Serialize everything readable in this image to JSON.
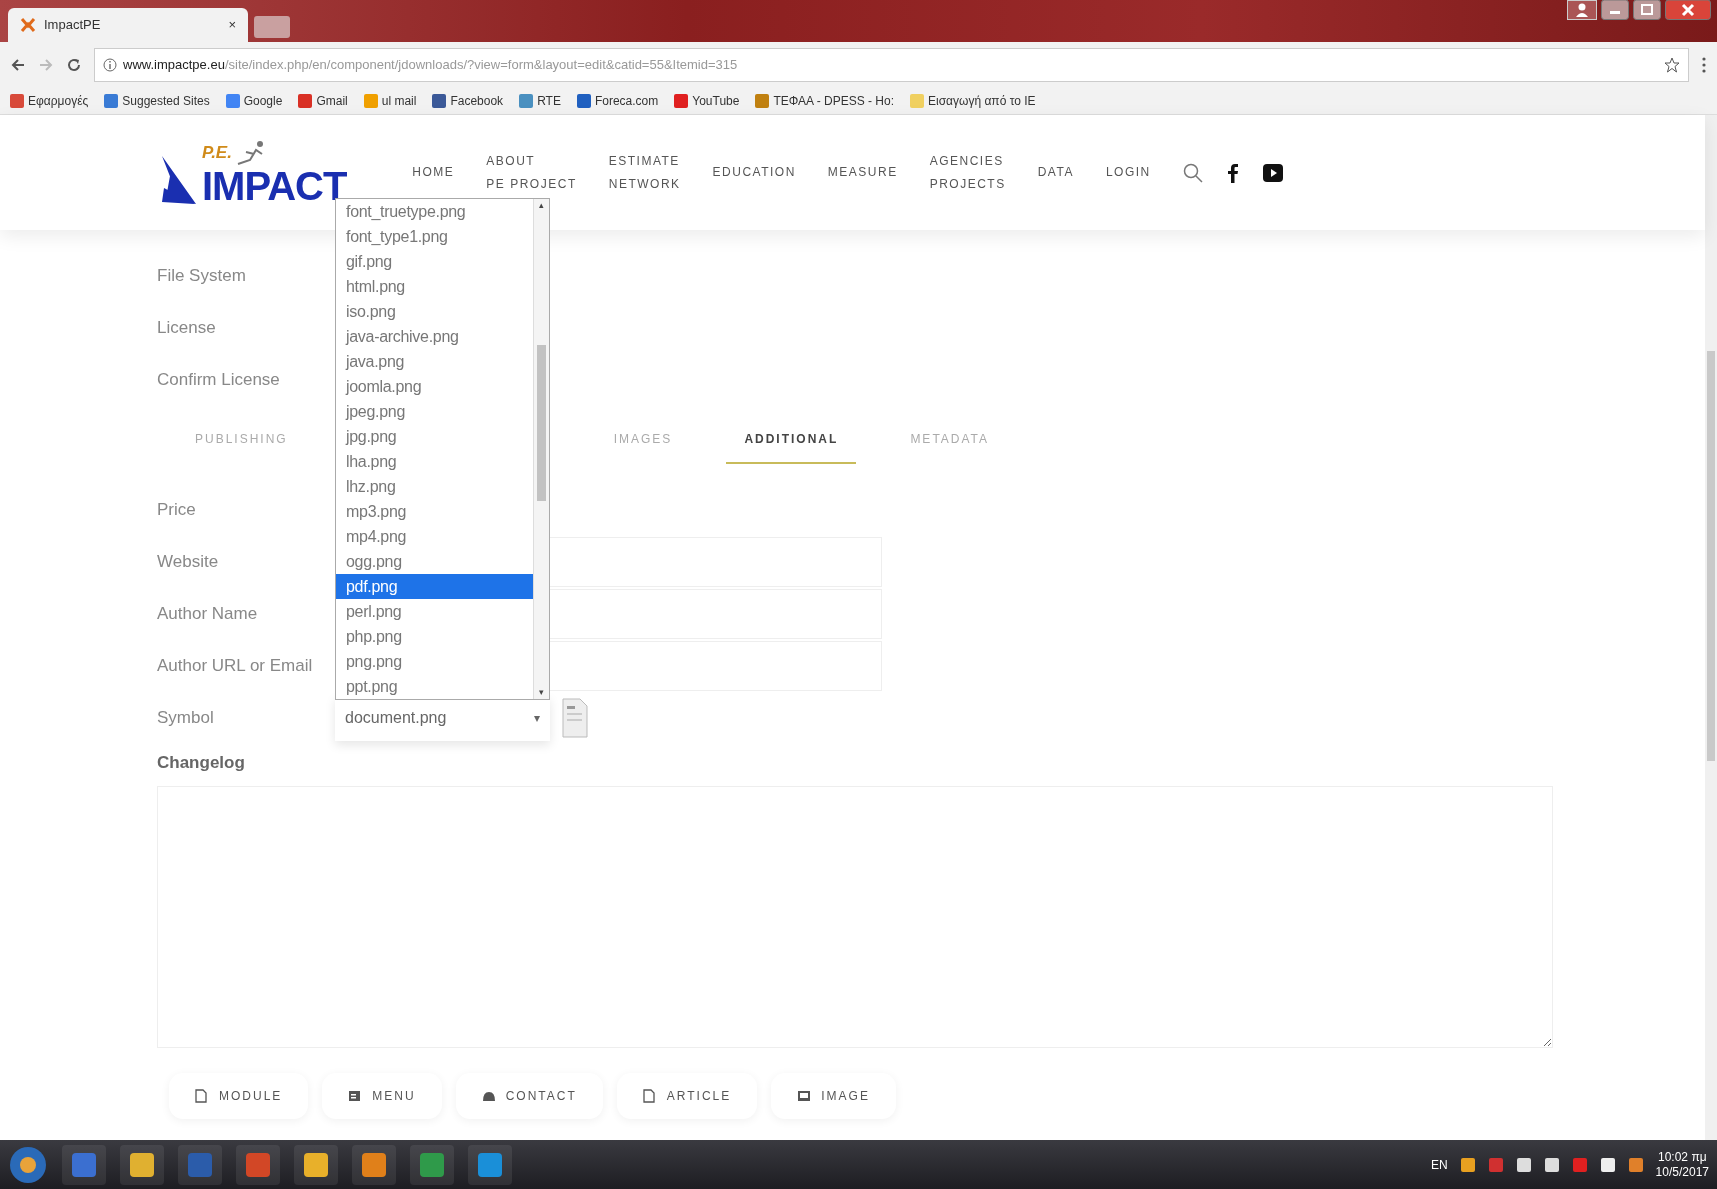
{
  "browser": {
    "tabs": [
      {
        "title": "ImpactPE",
        "close": "×",
        "selected": true
      }
    ],
    "address": {
      "host": "www.impactpe.eu",
      "path": "/site/index.php/en/component/jdownloads/?view=form&layout=edit&catid=55&Itemid=315"
    },
    "bookmarks": [
      {
        "label": "Εφαρμογές",
        "color": "#d84a3a"
      },
      {
        "label": "Suggested Sites",
        "color": "#3a7bd5"
      },
      {
        "label": "Google",
        "color": "#4285f4"
      },
      {
        "label": "Gmail",
        "color": "#d93025"
      },
      {
        "label": "ul mail",
        "color": "#f0a000"
      },
      {
        "label": "Facebook",
        "color": "#3b5998"
      },
      {
        "label": "RTE",
        "color": "#4a90c0"
      },
      {
        "label": "Foreca.com",
        "color": "#2060c0"
      },
      {
        "label": "YouTube",
        "color": "#e02020"
      },
      {
        "label": "ΤΕΦΑΑ - DPESS - Ho:",
        "color": "#c08010"
      },
      {
        "label": "Εισαγωγή από το IE",
        "color": "#f0d060"
      }
    ]
  },
  "site": {
    "logo": {
      "small": "P.E.",
      "big": "IMPACT"
    },
    "nav": [
      {
        "lines": [
          "HOME"
        ]
      },
      {
        "lines": [
          "ABOUT",
          "PE PROJECT"
        ]
      },
      {
        "lines": [
          "ESTIMATE",
          "NETWORK"
        ]
      },
      {
        "lines": [
          "EDUCATION"
        ]
      },
      {
        "lines": [
          "MEASURE"
        ]
      },
      {
        "lines": [
          "AGENCIES",
          "PROJECTS"
        ]
      },
      {
        "lines": [
          "DATA"
        ]
      },
      {
        "lines": [
          "LOGIN"
        ]
      }
    ]
  },
  "form": {
    "upper_labels": [
      "File System",
      "License",
      "Confirm License"
    ],
    "tabs": [
      {
        "label": "PUBLISHING",
        "selected": false
      },
      {
        "label": "IMAGES",
        "selected": false
      },
      {
        "label": "ADDITIONAL",
        "selected": true
      },
      {
        "label": "METADATA",
        "selected": false
      }
    ],
    "fields": [
      {
        "label": "Price",
        "kind": "none"
      },
      {
        "label": "Website",
        "kind": "input"
      },
      {
        "label": "Author Name",
        "kind": "input"
      },
      {
        "label": "Author URL or Email",
        "kind": "input"
      },
      {
        "label": "Symbol",
        "kind": "select",
        "value": "document.png",
        "arrow": "▾"
      }
    ],
    "dropdown": {
      "scroll_up": "▴",
      "scroll_down": "▾",
      "options": [
        {
          "label": "font_truetype.png",
          "selected": false
        },
        {
          "label": "font_type1.png",
          "selected": false
        },
        {
          "label": "gif.png",
          "selected": false
        },
        {
          "label": "html.png",
          "selected": false
        },
        {
          "label": "iso.png",
          "selected": false
        },
        {
          "label": "java-archive.png",
          "selected": false
        },
        {
          "label": "java.png",
          "selected": false
        },
        {
          "label": "joomla.png",
          "selected": false
        },
        {
          "label": "jpeg.png",
          "selected": false
        },
        {
          "label": "jpg.png",
          "selected": false
        },
        {
          "label": "lha.png",
          "selected": false
        },
        {
          "label": "lhz.png",
          "selected": false
        },
        {
          "label": "mp3.png",
          "selected": false
        },
        {
          "label": "mp4.png",
          "selected": false
        },
        {
          "label": "ogg.png",
          "selected": false
        },
        {
          "label": "pdf.png",
          "selected": true
        },
        {
          "label": "perl.png",
          "selected": false
        },
        {
          "label": "php.png",
          "selected": false
        },
        {
          "label": "png.png",
          "selected": false
        },
        {
          "label": "ppt.png",
          "selected": false
        }
      ]
    },
    "changelog_label": "Changelog",
    "bottom_buttons": [
      {
        "label": "MODULE",
        "kind": "doc"
      },
      {
        "label": "MENU",
        "kind": "menu"
      },
      {
        "label": "CONTACT",
        "kind": "person"
      },
      {
        "label": "ARTICLE",
        "kind": "doc"
      },
      {
        "label": "IMAGE",
        "kind": "image"
      }
    ]
  },
  "taskbar": {
    "language": "EN",
    "time": "10:02 πμ",
    "date": "10/5/2017"
  }
}
